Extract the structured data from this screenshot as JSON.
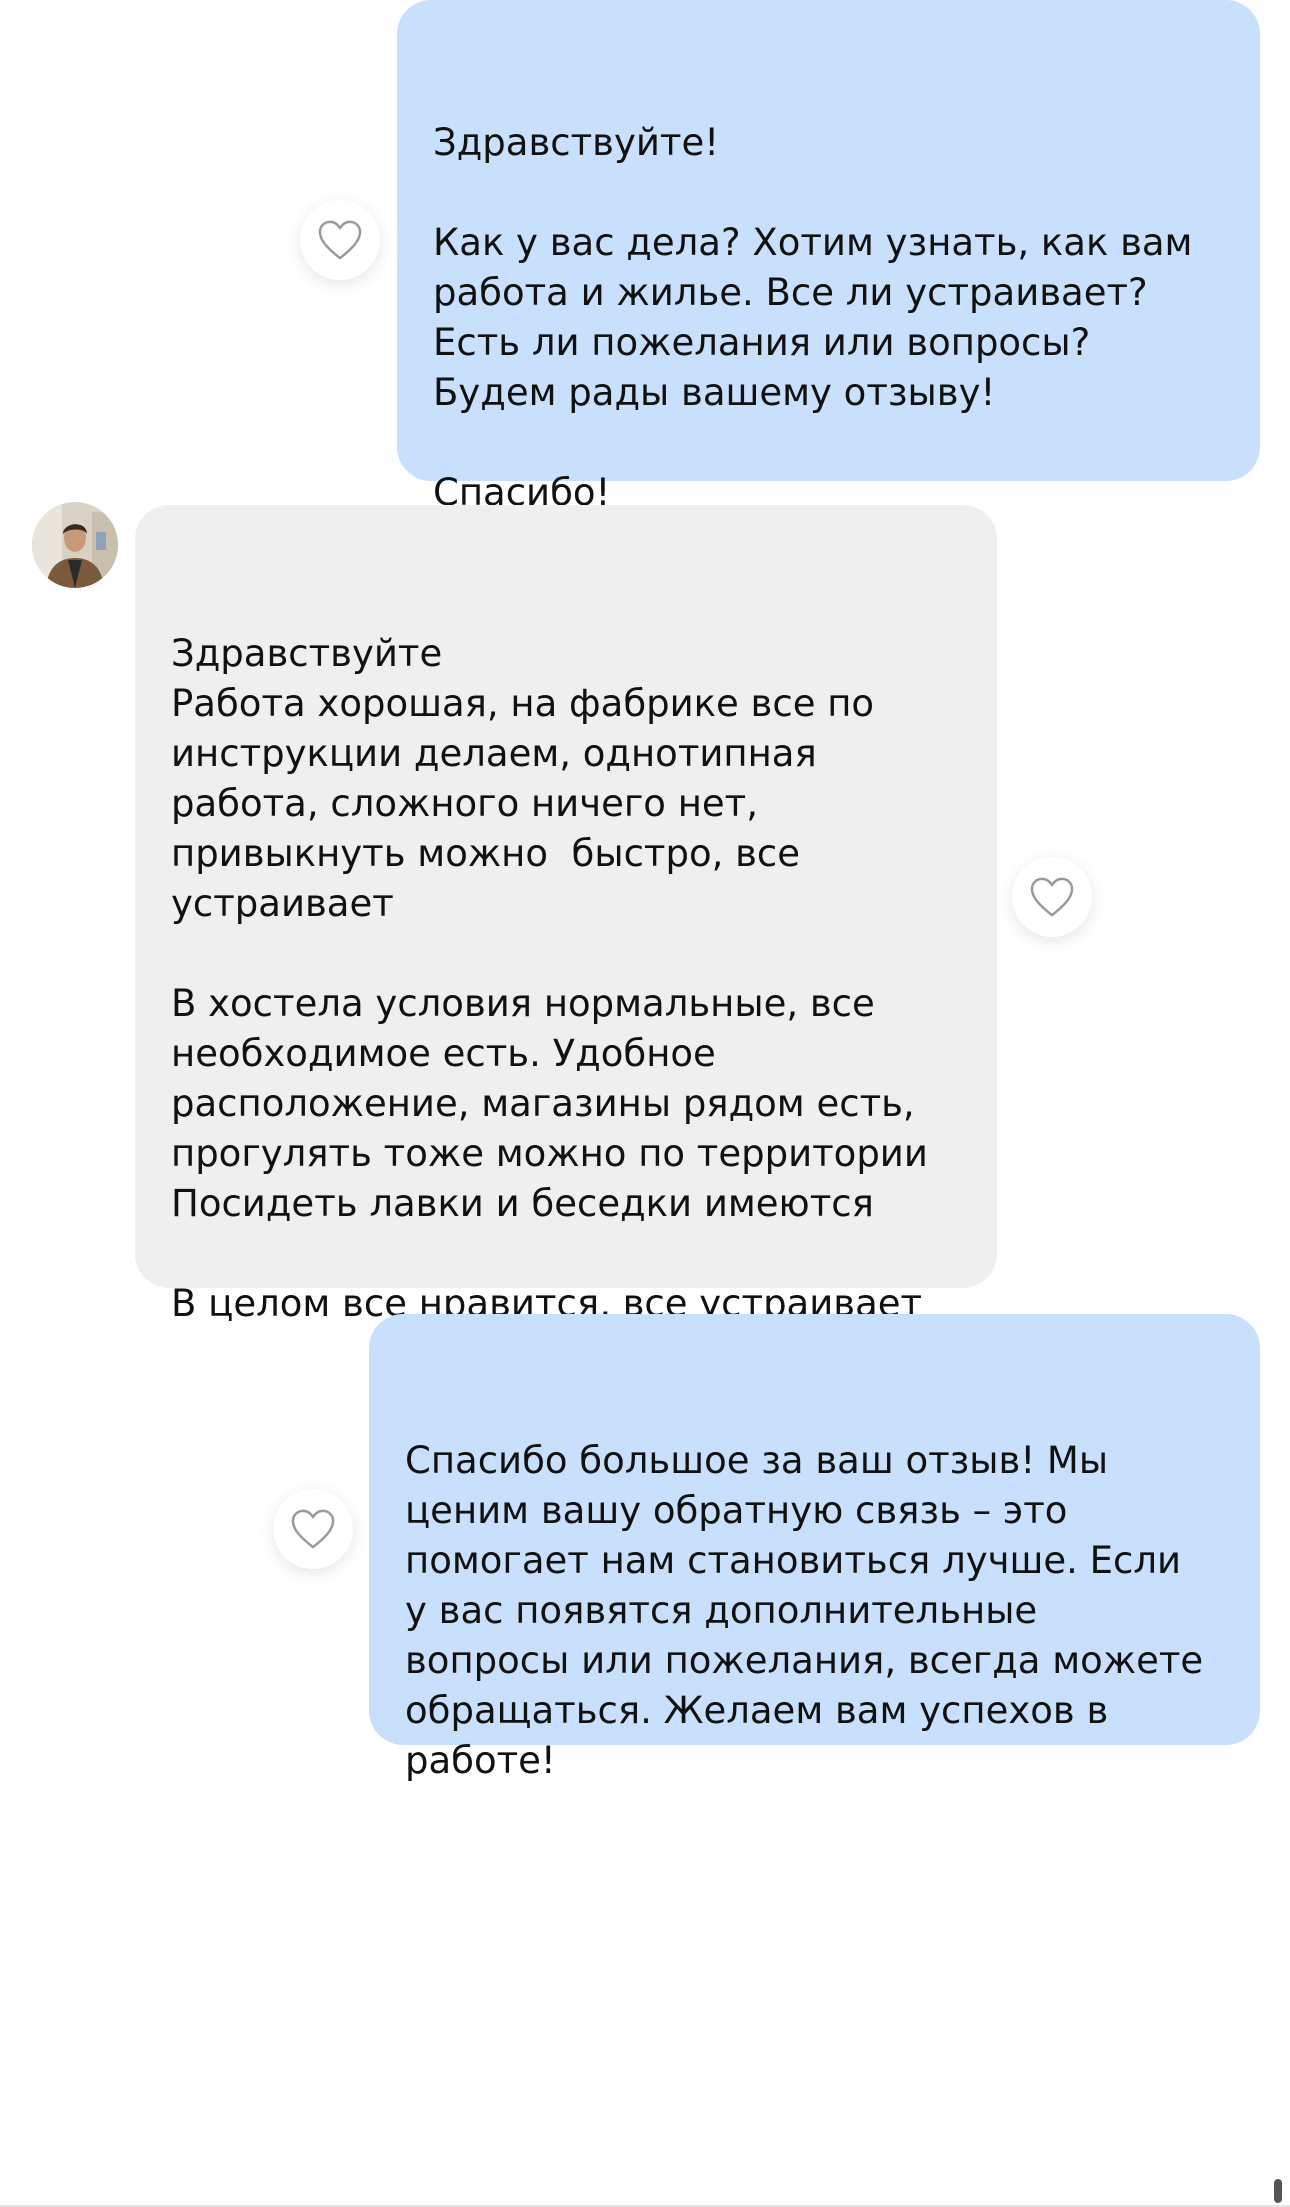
{
  "messages": [
    {
      "direction": "outgoing",
      "text": "Здравствуйте!\n\nКак у вас дела? Хотим узнать, как вам\nработа и жилье. Все ли устраивает?\nЕсть ли пожелания или вопросы?\nБудем рады вашему отзыву!\n\nСпасибо!"
    },
    {
      "direction": "incoming",
      "text": "Здравствуйте\nРабота хорошая, на фабрике все по\nинструкции делаем, однотипная\nработа, сложного ничего нет,\nпривыкнуть можно  быстро, все\nустраивает\n\nВ хостела условия нормальные, все\nнеобходимое есть. Удобное\nрасположение, магазины рядом есть,\nпрогулять тоже можно по территории\nПосидеть лавки и беседки имеются\n\nВ целом все нравится, все устраивает"
    },
    {
      "direction": "outgoing",
      "text": "Спасибо большое за ваш отзыв! Мы\nценим вашу обратную связь – это\nпомогает нам становиться лучше. Если\nу вас появятся дополнительные\nвопросы или пожелания, всегда можете\nобращаться. Желаем вам успехов в\nработе!"
    }
  ],
  "icons": {
    "like": "heart-outline-icon",
    "avatar": "user-avatar-photo"
  },
  "colors": {
    "outgoing_bubble": "#c8e0fb",
    "incoming_bubble": "#efefef",
    "background": "#ffffff",
    "heart_stroke": "#9a9a9a"
  }
}
